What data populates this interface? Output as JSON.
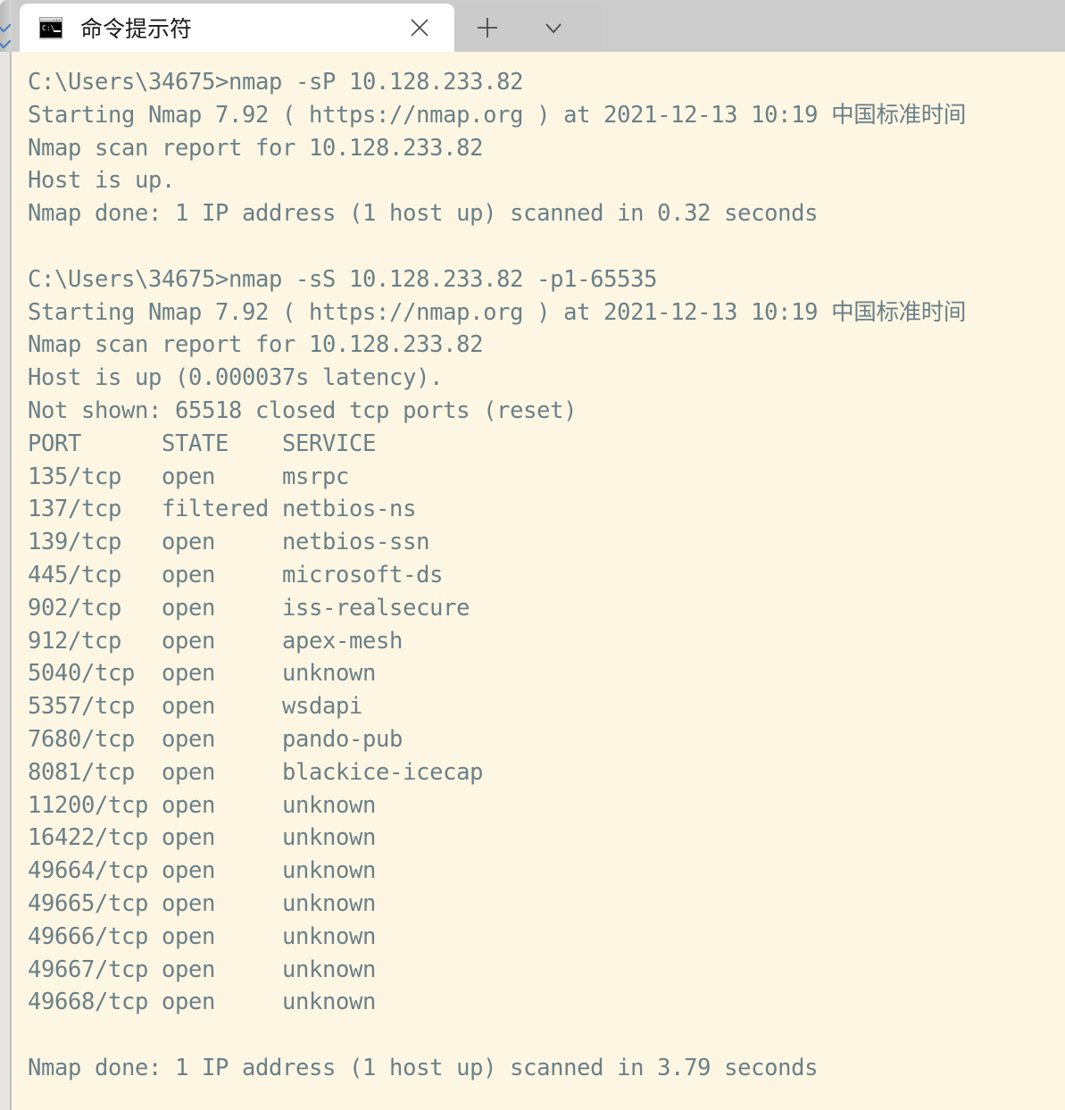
{
  "window": {
    "title": "命令提示符",
    "tab_title": "命令提示符",
    "tab_icon": "cmd-prompt-icon",
    "icon_prompt_text": "C:\\",
    "close_label": "×",
    "new_tab_label": "+",
    "dropdown_label": "∨",
    "colors": {
      "terminal_background": "#fdf6e3",
      "terminal_foreground": "#6a8088",
      "titlebar_background": "#cccccc",
      "active_tab_background": "#ffffff",
      "tab_title_color": "#1b1b1b"
    }
  },
  "terminal": {
    "prompt": "C:\\Users\\34675>",
    "lines": [
      "C:\\Users\\34675>nmap -sP 10.128.233.82",
      "Starting Nmap 7.92 ( https://nmap.org ) at 2021-12-13 10:19 中国标准时间",
      "Nmap scan report for 10.128.233.82",
      "Host is up.",
      "Nmap done: 1 IP address (1 host up) scanned in 0.32 seconds",
      "",
      "C:\\Users\\34675>nmap -sS 10.128.233.82 -p1-65535",
      "Starting Nmap 7.92 ( https://nmap.org ) at 2021-12-13 10:19 中国标准时间",
      "Nmap scan report for 10.128.233.82",
      "Host is up (0.000037s latency).",
      "Not shown: 65518 closed tcp ports (reset)",
      "PORT      STATE    SERVICE",
      "135/tcp   open     msrpc",
      "137/tcp   filtered netbios-ns",
      "139/tcp   open     netbios-ssn",
      "445/tcp   open     microsoft-ds",
      "902/tcp   open     iss-realsecure",
      "912/tcp   open     apex-mesh",
      "5040/tcp  open     unknown",
      "5357/tcp  open     wsdapi",
      "7680/tcp  open     pando-pub",
      "8081/tcp  open     blackice-icecap",
      "11200/tcp open     unknown",
      "16422/tcp open     unknown",
      "49664/tcp open     unknown",
      "49665/tcp open     unknown",
      "49666/tcp open     unknown",
      "49667/tcp open     unknown",
      "49668/tcp open     unknown",
      "",
      "Nmap done: 1 IP address (1 host up) scanned in 3.79 seconds"
    ],
    "commands": [
      {
        "command": "nmap -sP 10.128.233.82",
        "nmap_version": "7.92",
        "nmap_url": "https://nmap.org",
        "timestamp": "2021-12-13 10:19",
        "timezone": "中国标准时间",
        "target": "10.128.233.82",
        "host_status": "Host is up.",
        "summary": "Nmap done: 1 IP address (1 host up) scanned in 0.32 seconds",
        "elapsed_seconds": "0.32"
      },
      {
        "command": "nmap -sS 10.128.233.82 -p1-65535",
        "nmap_version": "7.92",
        "nmap_url": "https://nmap.org",
        "timestamp": "2021-12-13 10:19",
        "timezone": "中国标准时间",
        "target": "10.128.233.82",
        "host_status": "Host is up (0.000037s latency).",
        "latency": "0.000037s",
        "not_shown": "Not shown: 65518 closed tcp ports (reset)",
        "closed_port_count": "65518",
        "summary": "Nmap done: 1 IP address (1 host up) scanned in 3.79 seconds",
        "elapsed_seconds": "3.79"
      }
    ],
    "port_table": {
      "headers": [
        "PORT",
        "STATE",
        "SERVICE"
      ],
      "rows": [
        [
          "135/tcp",
          "open",
          "msrpc"
        ],
        [
          "137/tcp",
          "filtered",
          "netbios-ns"
        ],
        [
          "139/tcp",
          "open",
          "netbios-ssn"
        ],
        [
          "445/tcp",
          "open",
          "microsoft-ds"
        ],
        [
          "902/tcp",
          "open",
          "iss-realsecure"
        ],
        [
          "912/tcp",
          "open",
          "apex-mesh"
        ],
        [
          "5040/tcp",
          "open",
          "unknown"
        ],
        [
          "5357/tcp",
          "open",
          "wsdapi"
        ],
        [
          "7680/tcp",
          "open",
          "pando-pub"
        ],
        [
          "8081/tcp",
          "open",
          "blackice-icecap"
        ],
        [
          "11200/tcp",
          "open",
          "unknown"
        ],
        [
          "16422/tcp",
          "open",
          "unknown"
        ],
        [
          "49664/tcp",
          "open",
          "unknown"
        ],
        [
          "49665/tcp",
          "open",
          "unknown"
        ],
        [
          "49666/tcp",
          "open",
          "unknown"
        ],
        [
          "49667/tcp",
          "open",
          "unknown"
        ],
        [
          "49668/tcp",
          "open",
          "unknown"
        ]
      ]
    }
  }
}
